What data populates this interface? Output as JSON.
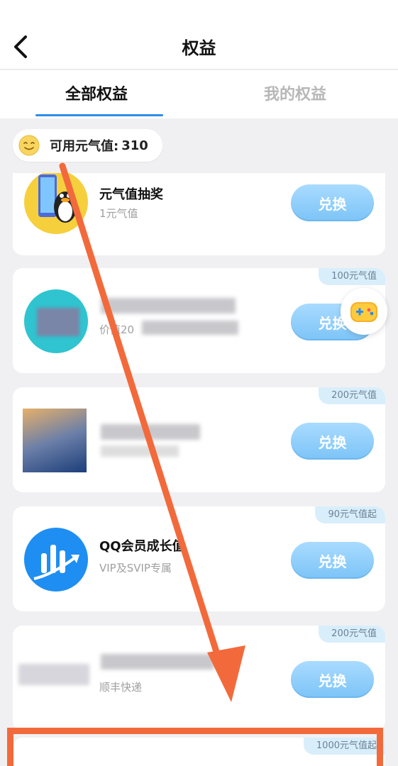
{
  "header": {
    "title": "权益",
    "back_icon": "chevron-left-icon"
  },
  "tabs": [
    {
      "label": "全部权益",
      "active": true
    },
    {
      "label": "我的权益",
      "active": false
    }
  ],
  "balance": {
    "label": "可用元气值:",
    "value": "310",
    "icon": "smiley-icon"
  },
  "items": [
    {
      "name": "元气值抽奖",
      "sub": "1元气值",
      "button": "兑换",
      "tag": ""
    },
    {
      "name": "",
      "sub": "价值20",
      "button": "兑换",
      "tag": "100元气值"
    },
    {
      "name": "",
      "sub": "",
      "button": "兑换",
      "tag": "200元气值"
    },
    {
      "name": "QQ会员成长值",
      "sub": "VIP及SVIP专属",
      "button": "兑换",
      "tag": "90元气值起"
    },
    {
      "name": "",
      "sub": "顺丰快递",
      "button": "兑换",
      "tag": "200元气值"
    },
    {
      "name": "",
      "sub": "",
      "button": "",
      "tag": "1000元气值起"
    }
  ],
  "colors": {
    "accent": "#2e8de6",
    "button": "#7cc4f7",
    "highlight": "#f26a3b"
  },
  "float_button": {
    "icon": "game-controller-icon"
  }
}
